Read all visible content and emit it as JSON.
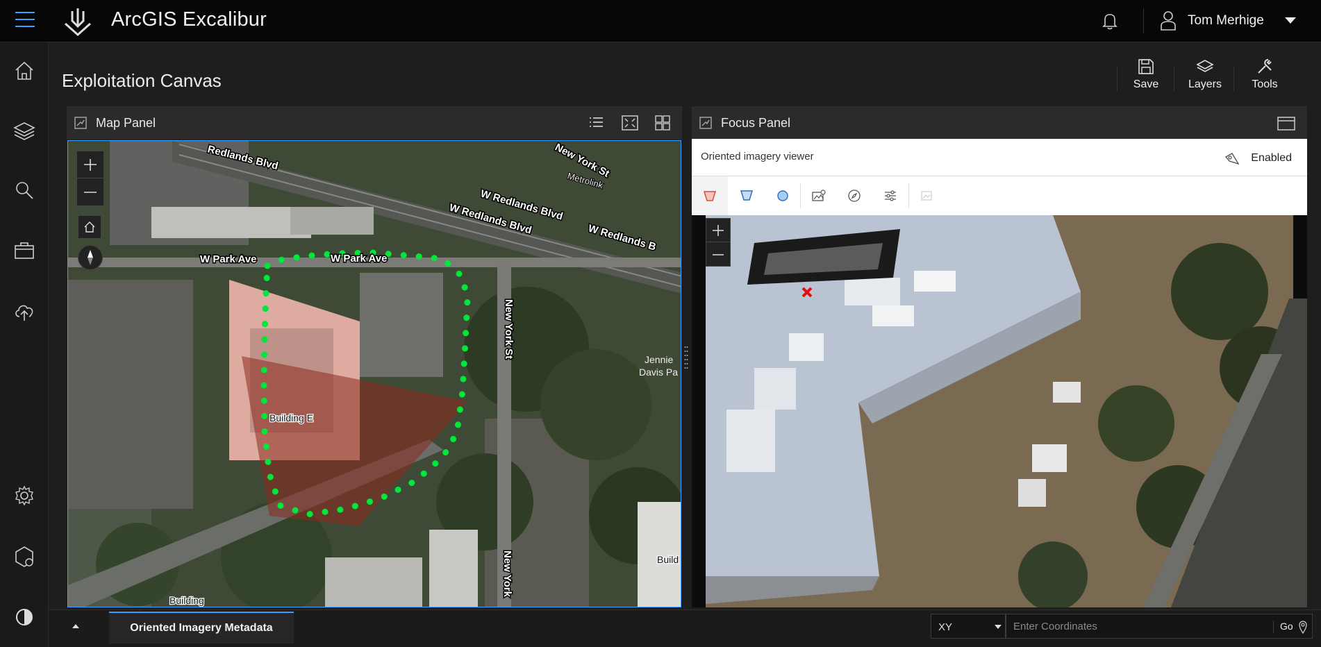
{
  "app": {
    "title": "ArcGIS Excalibur"
  },
  "user": {
    "name": "Tom Merhige"
  },
  "page": {
    "title": "Exploitation Canvas"
  },
  "toolbar": {
    "save_label": "Save",
    "layers_label": "Layers",
    "tools_label": "Tools"
  },
  "map_panel": {
    "title": "Map Panel",
    "labels": {
      "redlands_1": "Redlands Blvd",
      "york_top": "New York St",
      "metrolink": "Metrolink",
      "w_redlands_1": "W Redlands Blvd",
      "w_redlands_2": "W Redlands Blvd",
      "w_redlands_3": "W Redlands B",
      "park_1": "W Park Ave",
      "park_2": "W Park Ave",
      "new_york": "New York St",
      "new_york_2": "New York",
      "building_e": "Building E",
      "jennie": "Jennie",
      "davis": "Davis Pa",
      "building_bl": "Building",
      "building_br": "Build"
    }
  },
  "focus_panel": {
    "title": "Focus Panel",
    "viewer_label": "Oriented imagery viewer",
    "status": "Enabled"
  },
  "bottom": {
    "tab_label": "Oriented Imagery Metadata",
    "coord_system": "XY",
    "coord_placeholder": "Enter Coordinates",
    "go_label": "Go"
  },
  "colors": {
    "accent": "#3aa0ff",
    "footprint": "#00e63a",
    "marker": "#e01010"
  },
  "icons": [
    "menu-icon",
    "logo-icon",
    "bell-icon",
    "user-icon",
    "chevron-down-icon",
    "home-icon",
    "layers-icon",
    "search-icon",
    "briefcase-icon",
    "upload-cloud-icon",
    "gear-icon",
    "settings-hex-icon",
    "contrast-icon",
    "save-icon",
    "tools-icon",
    "list-icon",
    "expand-icon",
    "grid-icon",
    "restore-icon",
    "compass-icon",
    "pin-icon"
  ]
}
